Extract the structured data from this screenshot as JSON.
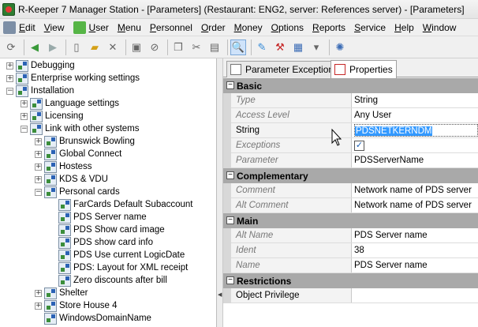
{
  "window": {
    "title": "R-Keeper 7 Manager Station - [Parameters] (Restaurant: ENG2, server: References server) - [Parameters]"
  },
  "menu": {
    "items": [
      {
        "label": "Edit",
        "ul": "E",
        "rest": "dit",
        "icon": "edit-icon",
        "color": "#7d8fa6"
      },
      {
        "label": "View",
        "ul": "V",
        "rest": "iew"
      },
      {
        "label": "User",
        "ul": "U",
        "rest": "ser",
        "icon": "user-icon",
        "color": "#56b546"
      },
      {
        "label": "Menu",
        "ul": "M",
        "rest": "enu"
      },
      {
        "label": "Personnel",
        "ul": "P",
        "rest": "ersonnel"
      },
      {
        "label": "Order",
        "ul": "O",
        "rest": "rder"
      },
      {
        "label": "Money",
        "ul": "M",
        "rest": "oney"
      },
      {
        "label": "Options",
        "ul": "O",
        "rest": "ptions"
      },
      {
        "label": "Reports",
        "ul": "R",
        "rest": "eports"
      },
      {
        "label": "Service",
        "ul": "S",
        "rest": "ervice"
      },
      {
        "label": "Help",
        "ul": "H",
        "rest": "elp"
      },
      {
        "label": "Window",
        "ul": "W",
        "rest": "indow"
      }
    ]
  },
  "toolbar": {
    "buttons": [
      {
        "name": "refresh-icon",
        "glyph": "⟳"
      },
      {
        "sep": true
      },
      {
        "name": "back-icon",
        "glyph": "◀",
        "color": "#3a9a3a"
      },
      {
        "name": "forward-icon",
        "glyph": "▶",
        "color": "#9aa"
      },
      {
        "sep": true
      },
      {
        "name": "new-document-icon",
        "glyph": "▯"
      },
      {
        "name": "open-folder-icon",
        "glyph": "▰",
        "color": "#d4a017"
      },
      {
        "name": "delete-icon",
        "glyph": "✕"
      },
      {
        "sep": true
      },
      {
        "name": "save-icon",
        "glyph": "▣"
      },
      {
        "name": "cancel-icon",
        "glyph": "⊘"
      },
      {
        "sep": true
      },
      {
        "name": "copy-icon",
        "glyph": "❐"
      },
      {
        "name": "cut-icon",
        "glyph": "✂"
      },
      {
        "name": "paste-icon",
        "glyph": "▤"
      },
      {
        "sep": true
      },
      {
        "name": "find-icon",
        "glyph": "🔍",
        "selected": true
      },
      {
        "sep": true
      },
      {
        "name": "brush-icon",
        "glyph": "✎",
        "color": "#3a8dd8"
      },
      {
        "name": "tools-icon",
        "glyph": "⚒",
        "color": "#c62828"
      },
      {
        "name": "table-view-icon",
        "glyph": "▦",
        "color": "#3a6bb5"
      },
      {
        "name": "dropdown-arrow-icon",
        "glyph": "▾"
      },
      {
        "sep": true
      },
      {
        "name": "settings-gear-icon",
        "glyph": "✺",
        "color": "#3a6bb5"
      }
    ]
  },
  "tree": {
    "nodes": [
      {
        "label": "Debugging",
        "level": 0,
        "exp": "+"
      },
      {
        "label": "Enterprise working settings",
        "level": 0,
        "exp": "+"
      },
      {
        "label": "Installation",
        "level": 0,
        "exp": "−"
      },
      {
        "label": "Language settings",
        "level": 1,
        "exp": "+"
      },
      {
        "label": "Licensing",
        "level": 1,
        "exp": "+"
      },
      {
        "label": "Link with other systems",
        "level": 1,
        "exp": "−"
      },
      {
        "label": "Brunswick Bowling",
        "level": 2,
        "exp": "+"
      },
      {
        "label": "Global Connect",
        "level": 2,
        "exp": "+"
      },
      {
        "label": "Hostess",
        "level": 2,
        "exp": "+"
      },
      {
        "label": "KDS & VDU",
        "level": 2,
        "exp": "+"
      },
      {
        "label": "Personal cards",
        "level": 2,
        "exp": "−"
      },
      {
        "label": "FarCards Default Subaccount",
        "level": 3,
        "exp": ""
      },
      {
        "label": "PDS Server name",
        "level": 3,
        "exp": ""
      },
      {
        "label": "PDS Show card image",
        "level": 3,
        "exp": ""
      },
      {
        "label": "PDS show card info",
        "level": 3,
        "exp": ""
      },
      {
        "label": "PDS Use current LogicDate",
        "level": 3,
        "exp": ""
      },
      {
        "label": "PDS: Layout for XML receipt",
        "level": 3,
        "exp": ""
      },
      {
        "label": "Zero discounts after bill",
        "level": 3,
        "exp": ""
      },
      {
        "label": "Shelter",
        "level": 2,
        "exp": "+"
      },
      {
        "label": "Store House 4",
        "level": 2,
        "exp": "+"
      },
      {
        "label": "WindowsDomainName",
        "level": 2,
        "exp": ""
      }
    ]
  },
  "tabs": [
    {
      "label": "Parameter Exceptions",
      "active": false
    },
    {
      "label": "Properties",
      "active": true
    }
  ],
  "grid": {
    "rows": [
      {
        "section": "Basic"
      },
      {
        "name": "Type",
        "value": "String",
        "italic": true
      },
      {
        "name": "Access Level",
        "value": "Any User",
        "italic": true
      },
      {
        "name": "String",
        "value": "PDSNETKERNDM",
        "italic": false,
        "editing": true
      },
      {
        "name": "Exceptions",
        "value": "✓",
        "italic": true,
        "checkbox": true
      },
      {
        "name": "Parameter",
        "value": "PDSServerName",
        "italic": true
      },
      {
        "section": "Complementary"
      },
      {
        "name": "Comment",
        "value": "Network name of PDS server",
        "italic": true
      },
      {
        "name": "Alt Comment",
        "value": "Network name of PDS server",
        "italic": true
      },
      {
        "section": "Main"
      },
      {
        "name": "Alt Name",
        "value": "PDS Server name",
        "italic": true
      },
      {
        "name": "Ident",
        "value": "38",
        "italic": true
      },
      {
        "name": "Name",
        "value": "PDS Server name",
        "italic": true
      },
      {
        "section": "Restrictions"
      },
      {
        "name": "Object Privilege",
        "value": "",
        "italic": false
      }
    ]
  },
  "colors": {
    "section_bg": "#a9a9a9",
    "selection": "#3399ff",
    "toolbar_selected": "#cfe3fa"
  }
}
